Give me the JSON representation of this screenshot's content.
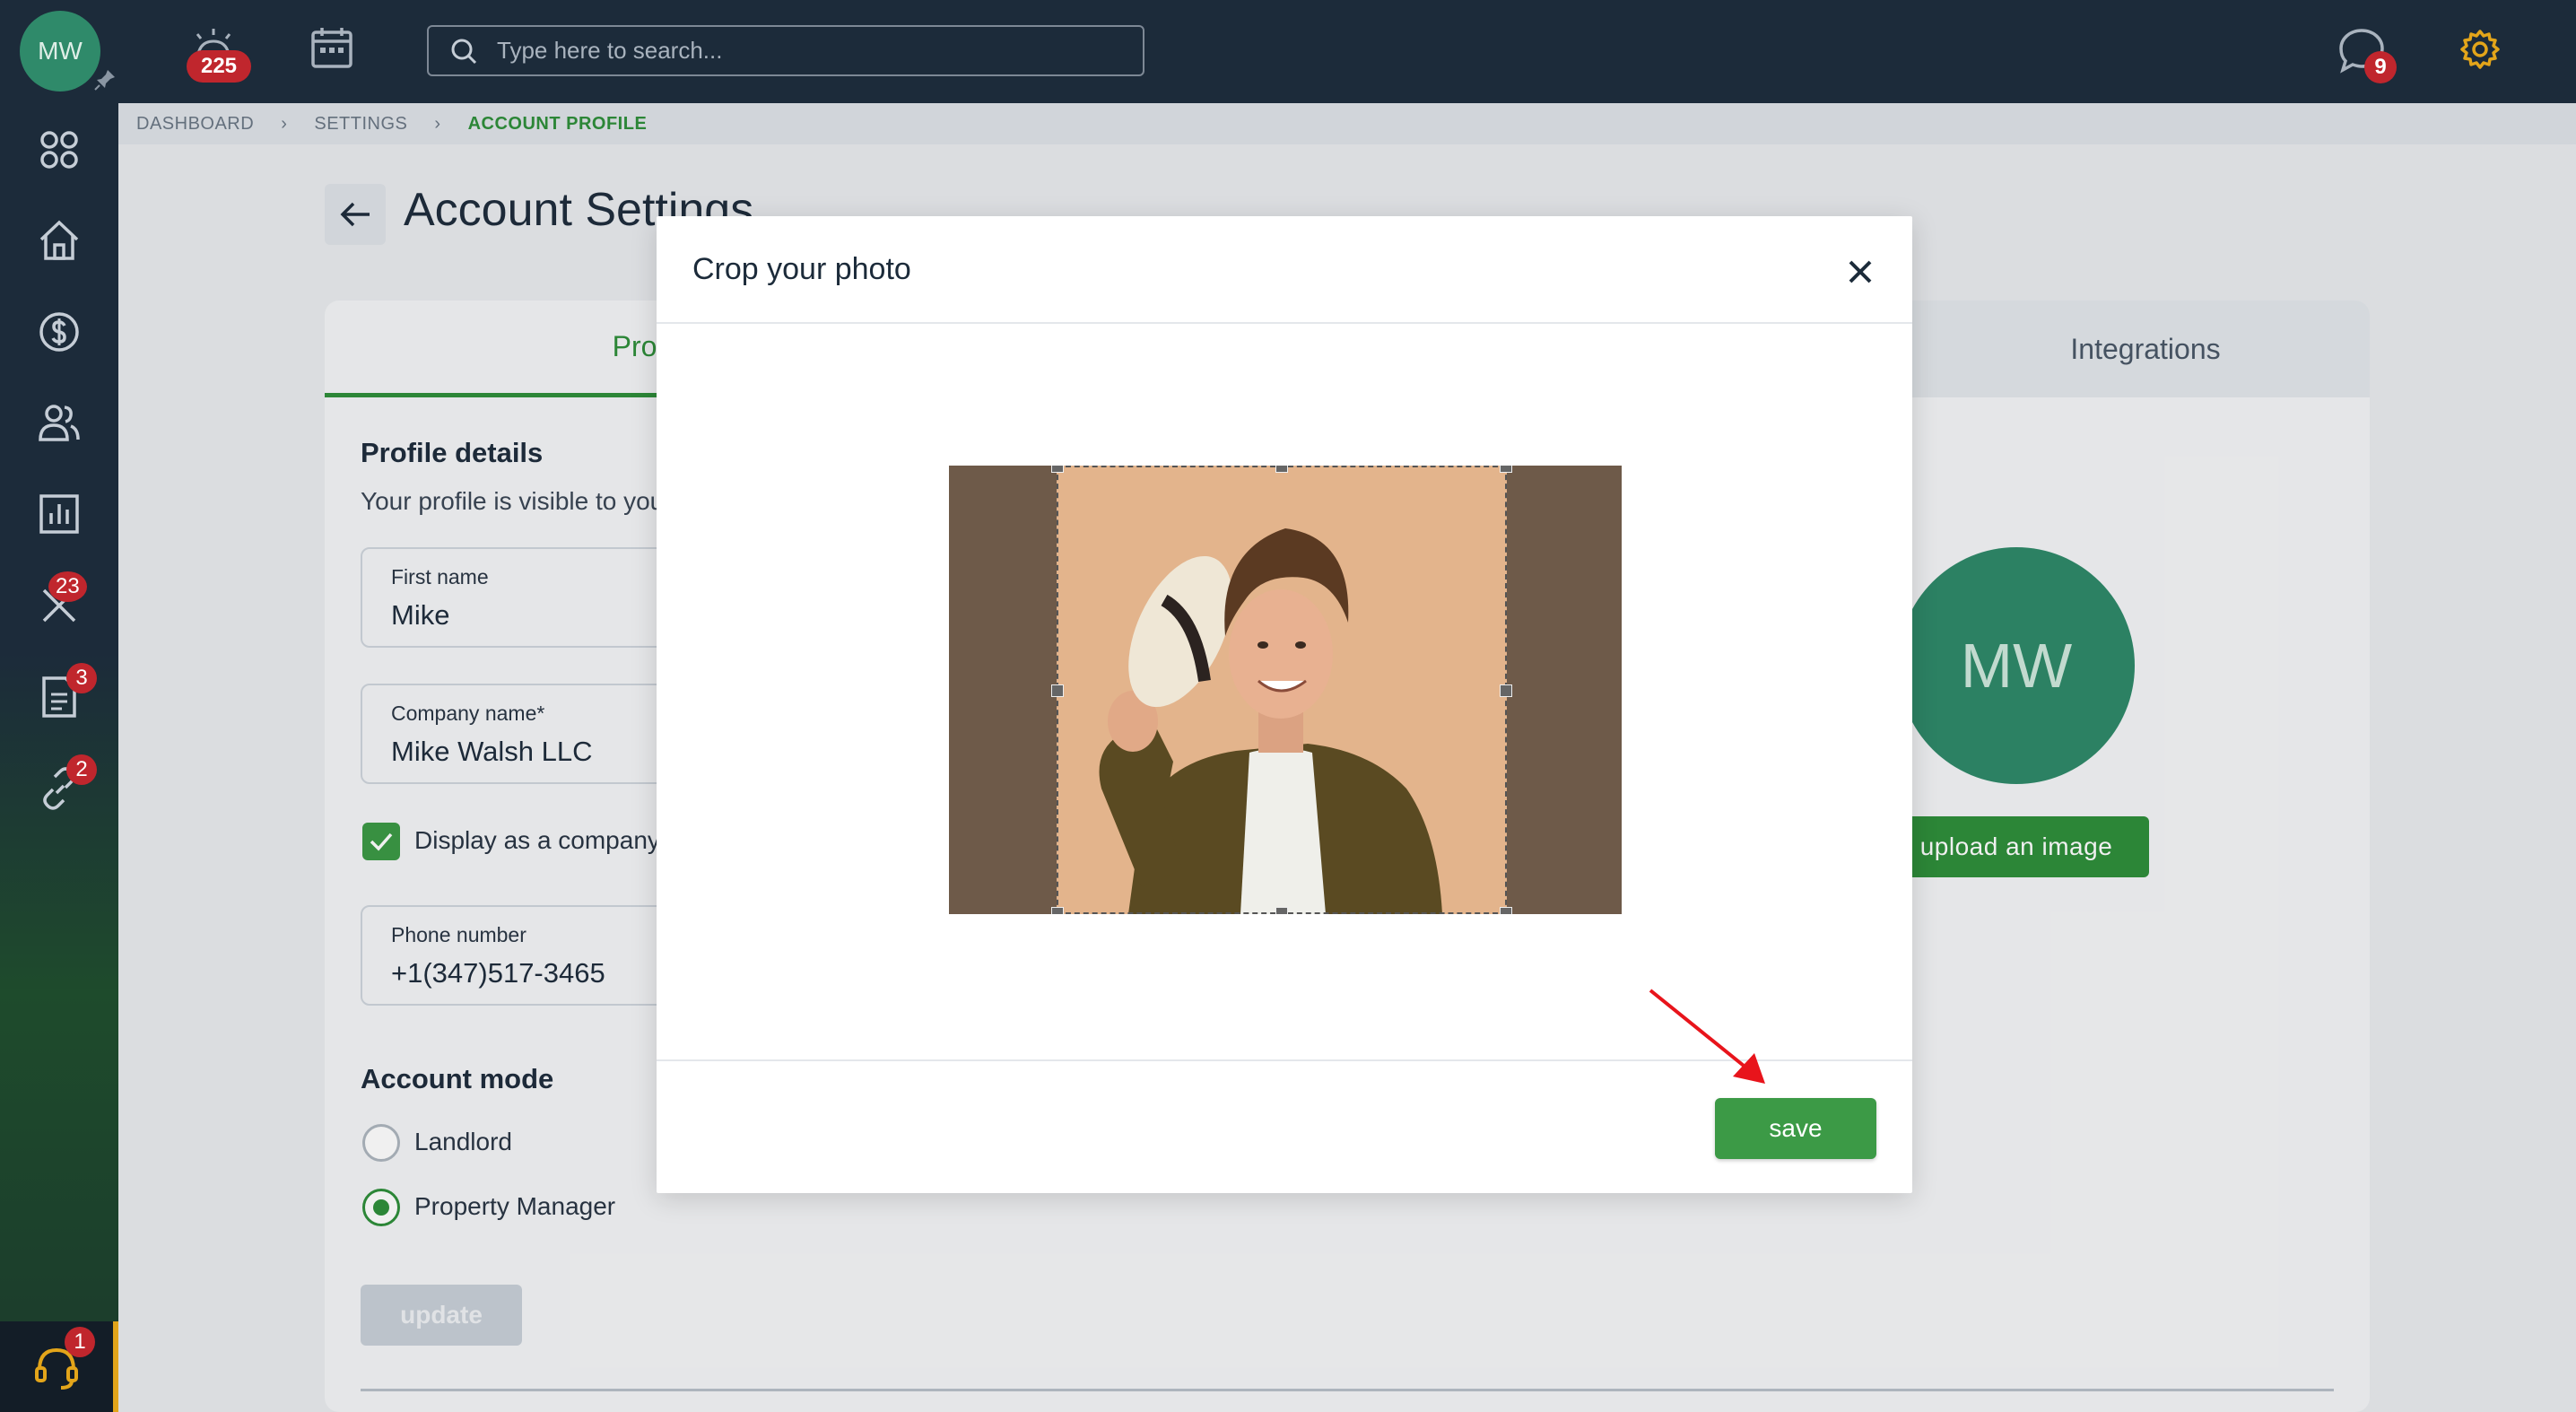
{
  "topbar": {
    "avatar_initials": "MW",
    "alarm_badge": "225",
    "search_placeholder": "Type here to search...",
    "chat_badge": "9",
    "settings_color": "#e3a51a"
  },
  "sidebar": {
    "items": [
      {
        "icon": "apps-grid-icon",
        "badge": ""
      },
      {
        "icon": "home-icon",
        "badge": ""
      },
      {
        "icon": "dollar-icon",
        "badge": ""
      },
      {
        "icon": "people-icon",
        "badge": ""
      },
      {
        "icon": "bar-chart-icon",
        "badge": ""
      },
      {
        "icon": "tools-icon",
        "badge": "23"
      },
      {
        "icon": "document-icon",
        "badge": "3"
      },
      {
        "icon": "link-icon",
        "badge": "2"
      }
    ],
    "support_badge": "1"
  },
  "breadcrumb": {
    "items": [
      "DASHBOARD",
      "SETTINGS",
      "ACCOUNT PROFILE"
    ]
  },
  "page": {
    "title": "Account Settings",
    "tabs": {
      "profile": "Prof",
      "integrations": "Integrations"
    },
    "profile_details": {
      "title": "Profile details",
      "description": "Your profile is visible to you"
    },
    "fields": {
      "first_name_label": "First name",
      "first_name_value": "Mike",
      "company_label": "Company name*",
      "company_value": "Mike Walsh LLC",
      "phone_label": "Phone number",
      "phone_value": "+1(347)517-3465"
    },
    "display_company_label": "Display as a company'",
    "account_mode": {
      "title": "Account mode",
      "options": [
        "Landlord",
        "Property Manager"
      ],
      "selected": "Property Manager"
    },
    "update_label": "update",
    "avatar_initials": "MW",
    "upload_label": "upload an image"
  },
  "modal": {
    "title": "Crop your photo",
    "save_label": "save"
  },
  "colors": {
    "brand_green": "#2f8f3b",
    "topbar": "#1c2b3a",
    "badge_red": "#c0262d"
  }
}
